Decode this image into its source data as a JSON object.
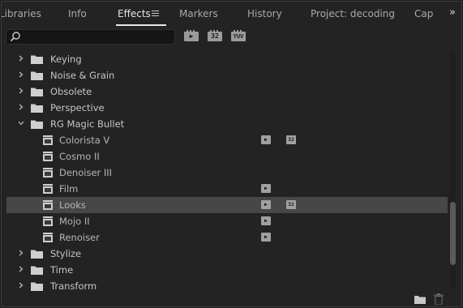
{
  "tabs": [
    {
      "label": "Libraries"
    },
    {
      "label": "Info"
    },
    {
      "label": "Effects"
    },
    {
      "label": "Markers"
    },
    {
      "label": "History"
    },
    {
      "label": "Project: decoding"
    },
    {
      "label": "Cap"
    }
  ],
  "active_tab": "Effects",
  "overflow_glyph": "»",
  "search": {
    "value": "",
    "placeholder": ""
  },
  "toolbar": {
    "accelerated_badge": "▶",
    "bit32_badge": "32",
    "yuv_badge": "YUV"
  },
  "rows": [
    {
      "label": "Keying",
      "type": "folder"
    },
    {
      "label": "Noise & Grain",
      "type": "folder"
    },
    {
      "label": "Obsolete",
      "type": "folder"
    },
    {
      "label": "Perspective",
      "type": "folder"
    },
    {
      "label": "RG Magic Bullet",
      "type": "folder-open"
    },
    {
      "label": "Colorista V",
      "type": "effect",
      "accelerated": true,
      "bit32": true
    },
    {
      "label": "Cosmo II",
      "type": "effect"
    },
    {
      "label": "Denoiser III",
      "type": "effect"
    },
    {
      "label": "Film",
      "type": "effect",
      "accelerated": true
    },
    {
      "label": "Looks",
      "type": "effect",
      "accelerated": true,
      "bit32": true,
      "selected": true
    },
    {
      "label": "Mojo II",
      "type": "effect",
      "accelerated": true
    },
    {
      "label": "Renoiser",
      "type": "effect",
      "accelerated": true
    },
    {
      "label": "Stylize",
      "type": "folder"
    },
    {
      "label": "Time",
      "type": "folder"
    },
    {
      "label": "Transform",
      "type": "folder"
    }
  ],
  "badge_text": {
    "accelerated": "▶",
    "bit32": "32"
  },
  "colors": {
    "selected_row": "#474747",
    "panel_bg": "#232323",
    "text": "#c6c6c6"
  }
}
